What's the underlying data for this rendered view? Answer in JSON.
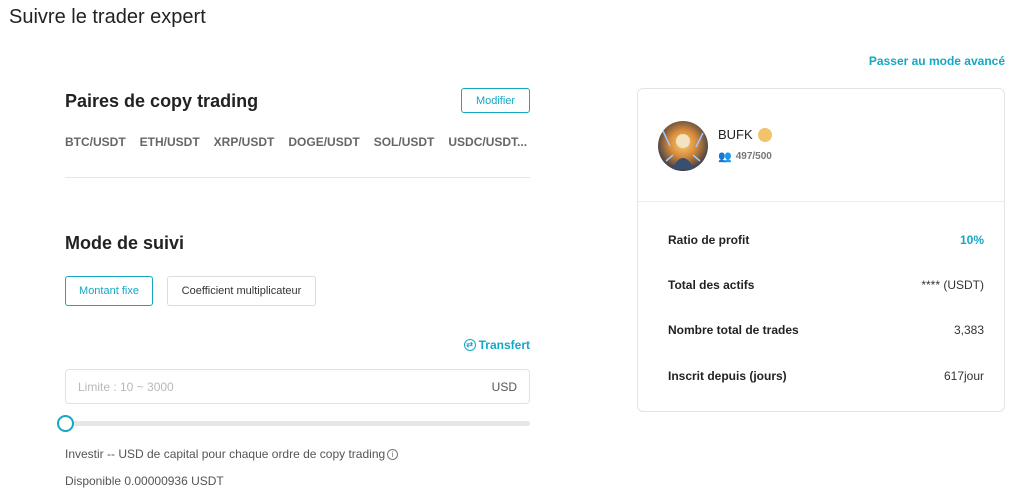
{
  "page": {
    "title": "Suivre le trader expert",
    "advanced_mode_link": "Passer au mode avancé"
  },
  "pairs": {
    "title": "Paires de copy trading",
    "modify_label": "Modifier",
    "items": [
      "BTC/USDT",
      "ETH/USDT",
      "XRP/USDT",
      "DOGE/USDT",
      "SOL/USDT",
      "USDC/USDT..."
    ]
  },
  "follow_mode": {
    "title": "Mode de suivi",
    "options": [
      "Montant fixe",
      "Coefficient multiplicateur"
    ],
    "selected": "Montant fixe",
    "transfer_label": "Transfert",
    "amount_placeholder": "Limite : 10 ~ 3000",
    "amount_unit": "USD",
    "slider_level": 0,
    "invest_note": "Investir -- USD de capital pour chaque ordre de copy trading",
    "available": "Disponible 0.00000936 USDT"
  },
  "trader": {
    "name": "BUFK",
    "followers": "497/500",
    "stats": [
      {
        "label": "Ratio de profit",
        "value": "10%"
      },
      {
        "label": "Total des actifs",
        "value": "**** (USDT)"
      },
      {
        "label": "Nombre total de trades",
        "value": "3,383"
      },
      {
        "label": "Inscrit depuis (jours)",
        "value": "617jour"
      }
    ]
  },
  "colors": {
    "accent": "#14a8c4"
  }
}
